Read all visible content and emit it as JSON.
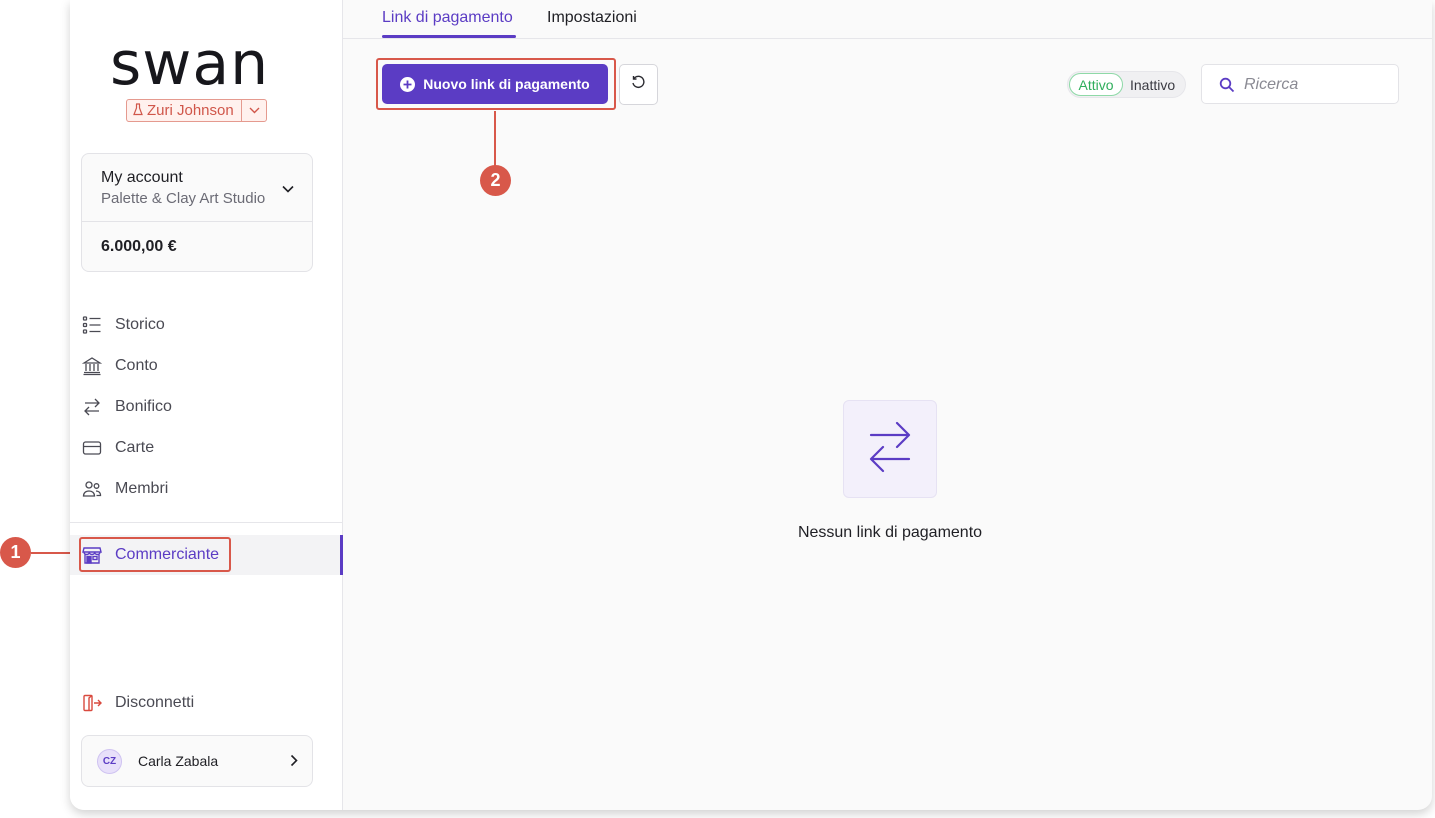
{
  "brand": {
    "logo": "swan"
  },
  "project": {
    "name": "Zuri Johnson"
  },
  "account": {
    "title": "My account",
    "subtitle": "Palette & Clay Art Studio",
    "balance": "6.000,00 €"
  },
  "nav": {
    "items": [
      {
        "label": "Storico",
        "icon": "list-icon"
      },
      {
        "label": "Conto",
        "icon": "bank-icon"
      },
      {
        "label": "Bonifico",
        "icon": "transfer-arrows-icon"
      },
      {
        "label": "Carte",
        "icon": "card-icon"
      },
      {
        "label": "Membri",
        "icon": "members-icon"
      }
    ],
    "active": {
      "label": "Commerciante",
      "icon": "storefront-icon"
    },
    "logout": {
      "label": "Disconnetti",
      "icon": "logout-icon"
    }
  },
  "user": {
    "initials": "CZ",
    "name": "Carla Zabala"
  },
  "tabs": [
    {
      "label": "Link di pagamento",
      "active": true
    },
    {
      "label": "Impostazioni",
      "active": false
    }
  ],
  "toolbar": {
    "new_link_label": "Nuovo link di pagamento",
    "filter_active": "Attivo",
    "filter_inactive": "Inattivo",
    "search_placeholder": "Ricerca"
  },
  "empty_state": {
    "message": "Nessun link di pagamento",
    "icon": "transfer-arrows-icon"
  },
  "annotations": {
    "step1": "1",
    "step2": "2"
  },
  "colors": {
    "accent": "#5b3cc4",
    "annotation": "#d8584a",
    "success": "#2fae5c",
    "danger": "#d94a3f"
  }
}
